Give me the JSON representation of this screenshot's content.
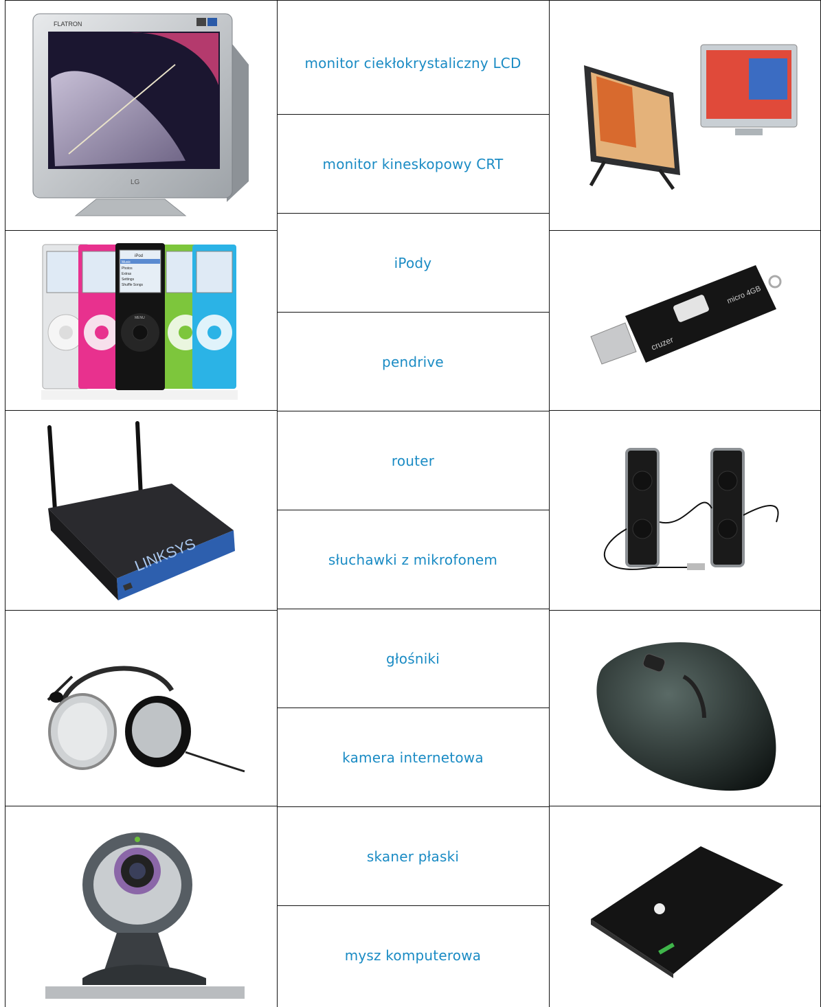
{
  "table": {
    "labels": [
      "monitor ciekłokrystaliczny LCD",
      "monitor kineskopowy CRT",
      "iPody",
      "pendrive",
      "router",
      "słuchawki z mikrofonem",
      "głośniki",
      "kamera internetowa",
      "skaner płaski",
      "mysz komputerowa"
    ],
    "left_images": [
      {
        "name": "crt-monitor-photo",
        "brand_text": "FLATRON",
        "logo_text": "LG"
      },
      {
        "name": "ipods-photo",
        "screen_title": "iPod",
        "menu_items": [
          "Music",
          "Photos",
          "Extras",
          "Settings",
          "Shuffle Songs"
        ],
        "wheel_text": "MENU"
      },
      {
        "name": "router-photo",
        "brand_text": "LINKSYS"
      },
      {
        "name": "headset-photo"
      },
      {
        "name": "webcam-photo"
      }
    ],
    "right_images": [
      {
        "name": "lcd-monitors-photo"
      },
      {
        "name": "pendrive-photo",
        "brand_text": "cruzer",
        "capacity_text": "micro 4GB"
      },
      {
        "name": "speakers-photo"
      },
      {
        "name": "mouse-photo"
      },
      {
        "name": "scanner-photo"
      }
    ]
  },
  "colors": {
    "label": "#1a8bc4",
    "border": "#111111"
  }
}
